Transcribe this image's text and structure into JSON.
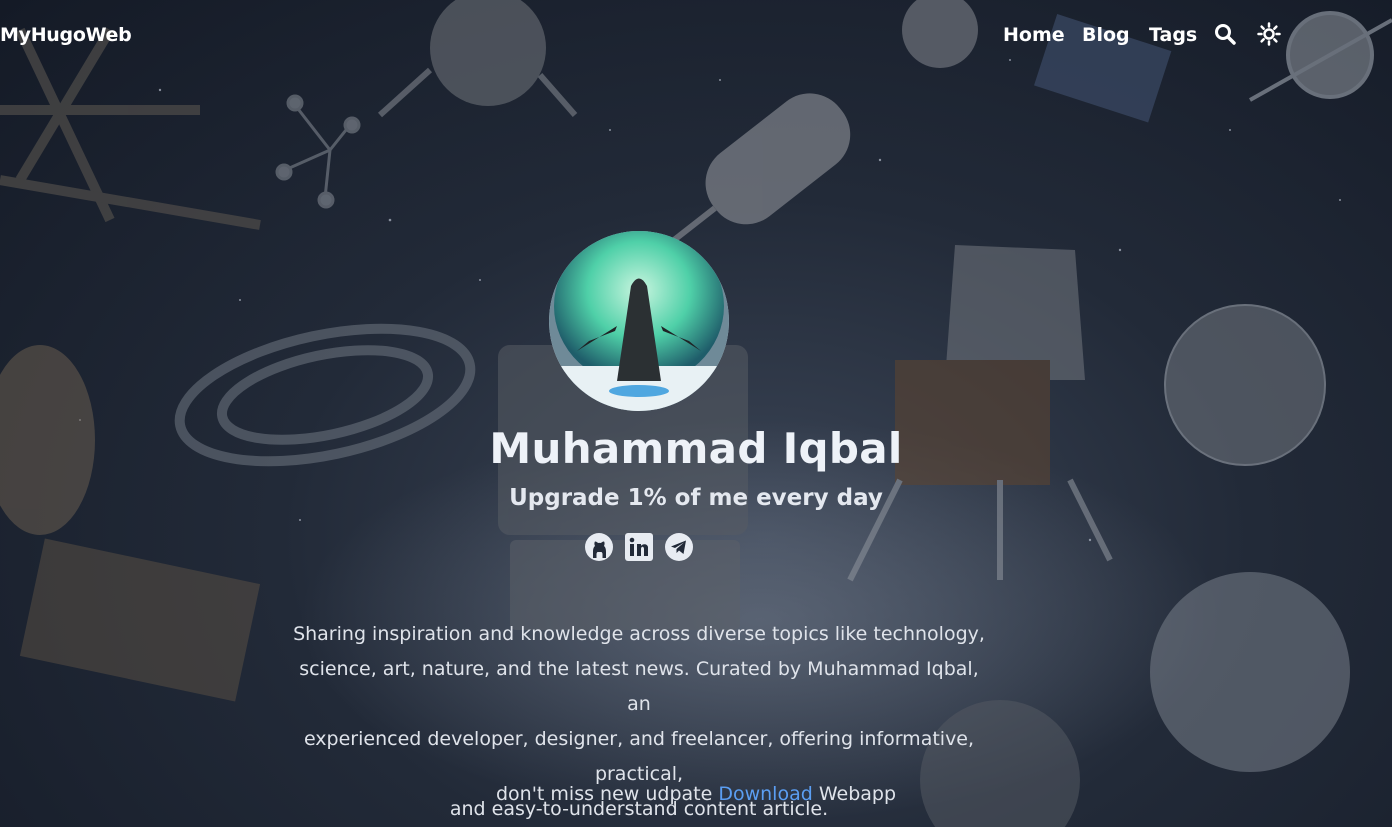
{
  "navbar": {
    "brand": "MyHugoWeb",
    "links": [
      "Home",
      "Blog",
      "Tags"
    ],
    "icons": [
      "search-icon",
      "theme-toggle-icon"
    ]
  },
  "profile": {
    "name": "Muhammad Iqbal",
    "tagline": "Upgrade 1% of me every day",
    "social_icons": [
      "github-icon",
      "linkedin-icon",
      "telegram-icon"
    ]
  },
  "description": {
    "lines": [
      "Sharing inspiration and knowledge across diverse topics like technology,",
      "science, art, nature, and the latest news. Curated by Muhammad Iqbal, an",
      "experienced developer, designer, and freelancer, offering informative, practical,",
      "and easy-to-understand content article."
    ]
  },
  "cta": {
    "prefix": "don't miss new udpate",
    "link": "Download",
    "suffix": "Webapp"
  },
  "colors": {
    "background": "#1c2330",
    "text": "#e7ebf2",
    "link": "#5b9ef2"
  }
}
